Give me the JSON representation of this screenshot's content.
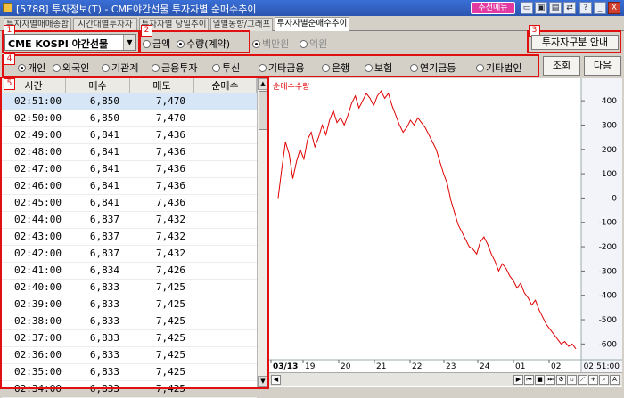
{
  "window": {
    "title": "[5788] 투자정보(T) - CME야간선물 투자자별 순매수추이",
    "recommend_label": "추천메뉴",
    "close_label": "X",
    "help_label": "?"
  },
  "tabs": [
    {
      "label": "투자자별매매종합"
    },
    {
      "label": "시간대별투자자"
    },
    {
      "label": "투자자별 당일추이"
    },
    {
      "label": "일별동향/그래프"
    },
    {
      "label": "투자자별순매수추이"
    }
  ],
  "markers": [
    "1",
    "2",
    "3",
    "4",
    "5"
  ],
  "controls": {
    "market_select": "CME KOSPI 야간선물",
    "unit_options": [
      {
        "label": "금액",
        "selected": false
      },
      {
        "label": "수량(계약)",
        "selected": true
      }
    ],
    "scale_options": [
      {
        "label": "백만원",
        "selected": true
      },
      {
        "label": "억원",
        "selected": false
      }
    ],
    "investor_guide_button": "투자자구분 안내",
    "investor_types": [
      {
        "label": "개인",
        "selected": true
      },
      {
        "label": "외국인",
        "selected": false
      },
      {
        "label": "기관계",
        "selected": false
      },
      {
        "label": "금융투자",
        "selected": false
      },
      {
        "label": "투신",
        "selected": false
      },
      {
        "label": "기타금융",
        "selected": false
      },
      {
        "label": "은행",
        "selected": false
      },
      {
        "label": "보험",
        "selected": false
      },
      {
        "label": "연기금등",
        "selected": false
      },
      {
        "label": "기타법인",
        "selected": false
      }
    ],
    "query_button": "조회",
    "next_button": "다음"
  },
  "table": {
    "columns": [
      "시간",
      "매수",
      "매도",
      "순매수"
    ],
    "rows": [
      {
        "time": "02:51:00",
        "buy": "6,850",
        "sell": "7,470",
        "net": ""
      },
      {
        "time": "02:50:00",
        "buy": "6,850",
        "sell": "7,470",
        "net": ""
      },
      {
        "time": "02:49:00",
        "buy": "6,841",
        "sell": "7,436",
        "net": ""
      },
      {
        "time": "02:48:00",
        "buy": "6,841",
        "sell": "7,436",
        "net": ""
      },
      {
        "time": "02:47:00",
        "buy": "6,841",
        "sell": "7,436",
        "net": ""
      },
      {
        "time": "02:46:00",
        "buy": "6,841",
        "sell": "7,436",
        "net": ""
      },
      {
        "time": "02:45:00",
        "buy": "6,841",
        "sell": "7,436",
        "net": ""
      },
      {
        "time": "02:44:00",
        "buy": "6,837",
        "sell": "7,432",
        "net": ""
      },
      {
        "time": "02:43:00",
        "buy": "6,837",
        "sell": "7,432",
        "net": ""
      },
      {
        "time": "02:42:00",
        "buy": "6,837",
        "sell": "7,432",
        "net": ""
      },
      {
        "time": "02:41:00",
        "buy": "6,834",
        "sell": "7,426",
        "net": ""
      },
      {
        "time": "02:40:00",
        "buy": "6,833",
        "sell": "7,425",
        "net": ""
      },
      {
        "time": "02:39:00",
        "buy": "6,833",
        "sell": "7,425",
        "net": ""
      },
      {
        "time": "02:38:00",
        "buy": "6,833",
        "sell": "7,425",
        "net": ""
      },
      {
        "time": "02:37:00",
        "buy": "6,833",
        "sell": "7,425",
        "net": ""
      },
      {
        "time": "02:36:00",
        "buy": "6,833",
        "sell": "7,425",
        "net": ""
      },
      {
        "time": "02:35:00",
        "buy": "6,833",
        "sell": "7,425",
        "net": ""
      },
      {
        "time": "02:34:00",
        "buy": "6,833",
        "sell": "7,425",
        "net": ""
      }
    ]
  },
  "chart": {
    "series_label": "순매수수량",
    "current_time_label": "02:51:00",
    "line_color": "#e00000",
    "y_ticks": [
      "400",
      "300",
      "200",
      "100",
      "0",
      "-100",
      "-200",
      "-300",
      "-400",
      "-500",
      "-600"
    ],
    "x_ticks": [
      "03/13",
      "19",
      "20",
      "21",
      "22",
      "23",
      "24",
      "01",
      "02"
    ]
  },
  "chart_data": {
    "type": "line",
    "series": [
      {
        "name": "순매수수량",
        "values": [
          0,
          120,
          230,
          180,
          80,
          150,
          200,
          160,
          240,
          270,
          210,
          250,
          300,
          260,
          320,
          360,
          310,
          330,
          300,
          340,
          390,
          420,
          370,
          400,
          430,
          410,
          380,
          420,
          440,
          410,
          430,
          380,
          340,
          300,
          270,
          290,
          320,
          300,
          330,
          310,
          290,
          260,
          230,
          200,
          150,
          100,
          60,
          -10,
          -60,
          -110,
          -140,
          -170,
          -200,
          -210,
          -230,
          -180,
          -160,
          -190,
          -230,
          -260,
          -300,
          -270,
          -290,
          -320,
          -340,
          -370,
          -350,
          -390,
          -410,
          -440,
          -420,
          -460,
          -490,
          -520,
          -540,
          -560,
          -580,
          -600,
          -590,
          -610,
          -600,
          -620
        ]
      }
    ],
    "x_range": [
      "03/13",
      "02:51:00"
    ],
    "ylim": [
      -650,
      470
    ],
    "grid": false,
    "legend": "top-left"
  }
}
